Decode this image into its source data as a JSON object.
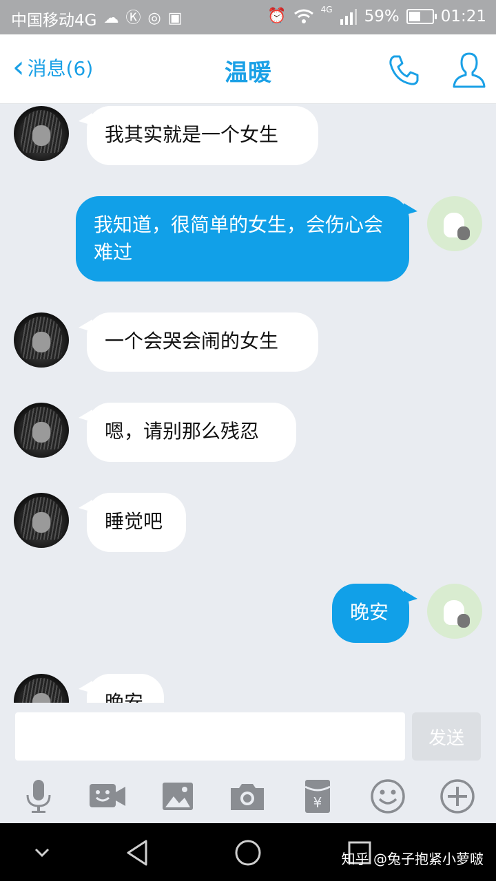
{
  "status_bar": {
    "carrier": "中国移动4G",
    "network": "4G",
    "battery": "59%",
    "battery_level": 0.59,
    "time": "01:21"
  },
  "header": {
    "back_label": "消息(6)",
    "title": "温暖",
    "accent_color": "#1aa0e6"
  },
  "messages": [
    {
      "side": "in",
      "text": "我其实就是一个女生"
    },
    {
      "side": "out",
      "text": "我知道，很简单的女生，会伤心会难过"
    },
    {
      "side": "in",
      "text": "一个会哭会闹的女生"
    },
    {
      "side": "in",
      "text": "嗯，请别那么残忍"
    },
    {
      "side": "in",
      "text": "睡觉吧"
    },
    {
      "side": "out",
      "text": "晚安"
    },
    {
      "side": "in",
      "text": "晚安"
    }
  ],
  "composer": {
    "input_value": "",
    "send_label": "发送"
  },
  "toolbar": {
    "icons": [
      "microphone-icon",
      "video-icon",
      "image-icon",
      "camera-icon",
      "red-envelope-icon",
      "emoji-icon",
      "plus-icon"
    ]
  },
  "watermark": "知乎 @兔子抱紧小萝啵",
  "colors": {
    "bubble_out": "#11a0e8",
    "bubble_in": "#ffffff",
    "background": "#e9ecf1"
  }
}
